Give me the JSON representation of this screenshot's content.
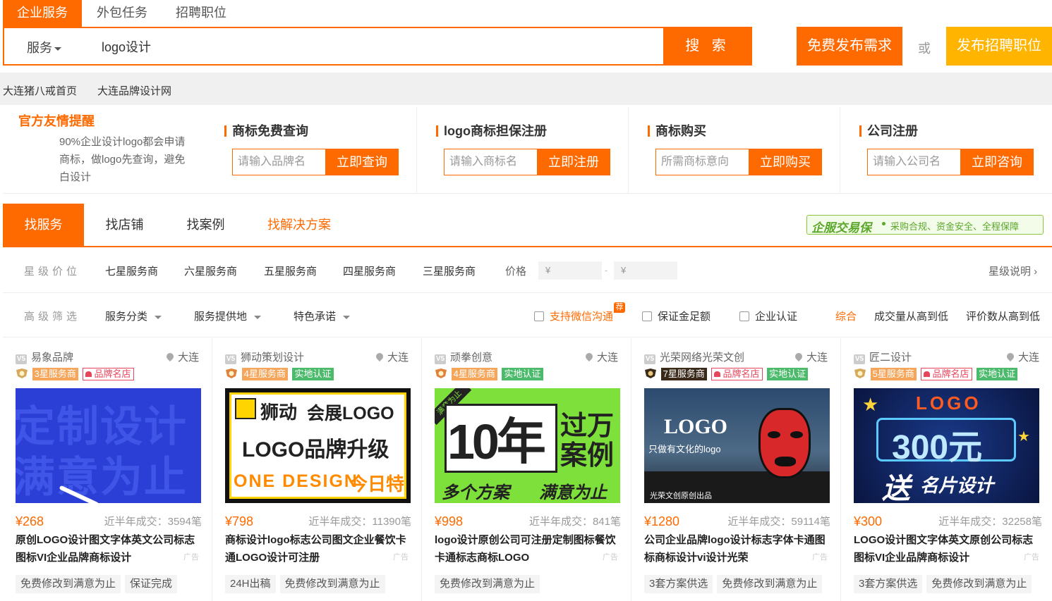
{
  "top_tabs": [
    "企业服务",
    "外包任务",
    "招聘职位"
  ],
  "search": {
    "category": "服务",
    "query": "logo设计",
    "button": "搜 索"
  },
  "actions": {
    "post_demand": "免费发布需求",
    "or": "或",
    "post_job": "发布招聘职位"
  },
  "breadcrumb": [
    "大连猪八戒首页",
    "大连品牌设计网"
  ],
  "notice": {
    "title": "官方友情提醒",
    "text": "90%企业设计logo都会申请商标，做logo先查询，避免白设计"
  },
  "promos": [
    {
      "title": "商标免费查询",
      "placeholder": "请输入品牌名",
      "button": "立即查询"
    },
    {
      "title": "logo商标担保注册",
      "placeholder": "请输入商标名",
      "button": "立即注册"
    },
    {
      "title": "商标购买",
      "placeholder": "所需商标意向",
      "button": "立即购买"
    },
    {
      "title": "公司注册",
      "placeholder": "请输入公司名",
      "button": "立即咨询"
    }
  ],
  "filter_tabs": [
    "找服务",
    "找店铺",
    "找案例",
    "找解决方案"
  ],
  "guarantee": {
    "brand": "企服交易保",
    "slogan": "采购合规、资金安全、全程保障"
  },
  "star_filter": {
    "label": "星级价位",
    "levels": [
      "七星服务商",
      "六星服务商",
      "五星服务商",
      "四星服务商",
      "三星服务商"
    ],
    "price_label": "价格",
    "currency": "¥",
    "dash": "-",
    "explain": "星级说明 ›"
  },
  "advanced_filter": {
    "label": "高级筛选",
    "dropdowns": [
      "服务分类",
      "服务提供地",
      "特色承诺"
    ],
    "checks": [
      "支持微信沟通",
      "保证金足额",
      "企业认证"
    ],
    "recommend_badge": "荐",
    "sorts": [
      "综合",
      "成交量从高到低",
      "评价数从高到低"
    ]
  },
  "cards": [
    {
      "shop": "易象品牌",
      "city": "大连",
      "star": "3星服务商",
      "brand": "品牌名店",
      "real": "",
      "price": "¥268",
      "sales": "近半年成交：3594笔",
      "title": "原创LOGO设计图文字体英文公司标志图标VI企业品牌商标设计",
      "ad": "广告",
      "tags": [
        "免费修改到满意为止",
        "保证完成"
      ],
      "thumb": [
        "定制设计",
        "满意为止"
      ]
    },
    {
      "shop": "狮动策划设计",
      "city": "大连",
      "star": "4星服务商",
      "brand": "",
      "real": "实地认证",
      "price": "¥798",
      "sales": "近半年成交：11390笔",
      "title": "商标设计logo标志公司图文企业餐饮卡通LOGO设计可注册",
      "ad": "广告",
      "tags": [
        "24H出稿",
        "免费修改到满意为止"
      ],
      "thumb": [
        "狮动",
        "会展LOGO",
        "LOGO品牌升级",
        "ONE DESIGN",
        "今日特"
      ]
    },
    {
      "shop": "顽拳创意",
      "city": "大连",
      "star": "4星服务商",
      "brand": "",
      "real": "实地认证",
      "price": "¥998",
      "sales": "近半年成交：841笔",
      "title": "logo设计原创公司可注册定制图标餐饮卡通标志商标LOGO",
      "ad": "广告",
      "tags": [
        "免费修改到满意为止"
      ],
      "thumb": [
        "满意为止",
        "10年",
        "过万",
        "案例",
        "多个方案",
        "满意为止"
      ]
    },
    {
      "shop": "光荣网络光荣文创",
      "city": "大连",
      "star": "7星服务商",
      "brand": "品牌名店",
      "real": "实地认证",
      "price": "¥1280",
      "sales": "近半年成交：59114笔",
      "title": "公司企业品牌logo设计标志字体卡通图标商标设计vi设计光荣",
      "ad": "广告",
      "tags": [
        "3套方案供选",
        "免费修改到满意为止"
      ],
      "thumb": [
        "LOGO",
        "只做有文化的logo",
        "光荣文创原创出品"
      ]
    },
    {
      "shop": "匠二设计",
      "city": "大连",
      "star": "5星服务商",
      "brand": "品牌名店",
      "real": "实地认证",
      "price": "¥300",
      "sales": "近半年成交：32258笔",
      "title": "LOGO设计图文字体英文原创公司标志图标VI企业品牌商标设计",
      "ad": "广告",
      "tags": [
        "3套方案供选",
        "免费修改到满意为止"
      ],
      "thumb": [
        "LOGO",
        "300元",
        "送",
        "名片设计"
      ]
    }
  ],
  "colors": {
    "accent": "#ff6a00",
    "yellow": "#ffb400",
    "green": "#4cba6b",
    "red": "#e6455b"
  }
}
